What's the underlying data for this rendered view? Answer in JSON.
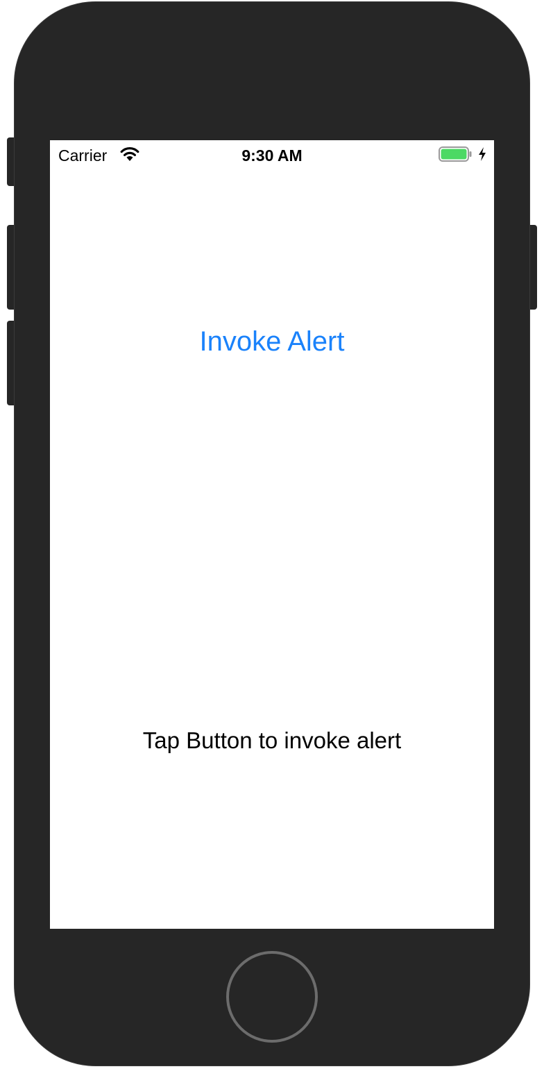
{
  "status_bar": {
    "carrier": "Carrier",
    "time": "9:30 AM",
    "wifi_icon": "wifi-icon",
    "battery_icon": "battery-icon",
    "charging_icon": "charging-bolt-icon",
    "battery_color": "#4cd964"
  },
  "main": {
    "invoke_button_label": "Invoke Alert",
    "info_label": "Tap Button to invoke alert",
    "accent_color": "#1a82fb"
  },
  "device": {
    "body_color": "#262626"
  }
}
